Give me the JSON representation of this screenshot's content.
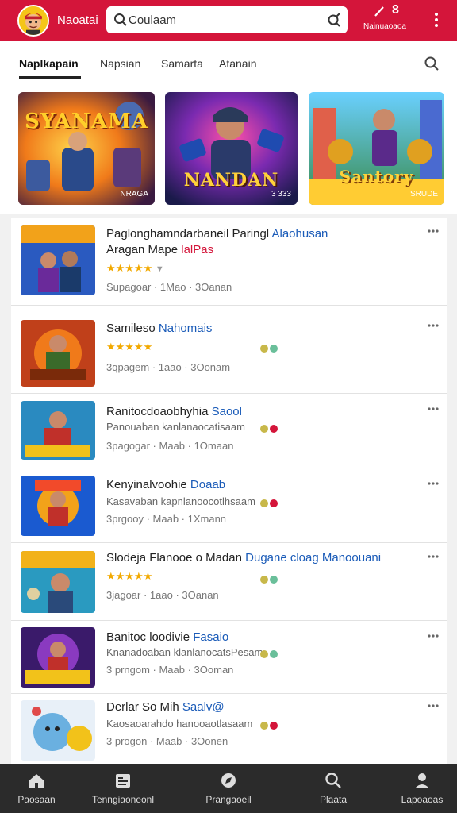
{
  "header": {
    "app_title": "Naoatai",
    "search_value": "Coulaam",
    "notif_count": "8",
    "account_label": "Nainuaoaoa",
    "colors": {
      "brand": "#d4153a"
    }
  },
  "tabs": [
    {
      "label": "Naplkapain"
    },
    {
      "label": "Napsian"
    },
    {
      "label": "Samarta"
    },
    {
      "label": "Atanain"
    }
  ],
  "featured": [
    {
      "title": "SYANAMA",
      "sub": "NRAGA"
    },
    {
      "title": "NANDAN",
      "sub": "3 333"
    },
    {
      "title": "Santory",
      "sub": "SRUDE"
    }
  ],
  "list": [
    {
      "title": "Paglonghamndarbaneil Paringl",
      "title_link": "Alaohusan",
      "title_line2": "Aragan Mape",
      "title_line2_red": "lalPas",
      "stars": "★★★★★",
      "meta": "Supagoar · 1Mao · 3Oanan"
    },
    {
      "title": "Samileso",
      "title_link": "Nahomais",
      "stars": "★★★★★",
      "meta": "3qpagem · 1aao · 3Oonam"
    },
    {
      "title": "Ranitocdoaobhyhia",
      "title_link": "Saool",
      "desc": "Panouaban kanlanaocatisaam",
      "meta": "3pagogar · Maab · 1Omaan"
    },
    {
      "title": "Kenyinalvoohie",
      "title_link": "Doaab",
      "desc": "Kasavaban kapnlanoocotlhsaam",
      "meta": "3prgooy · Maab · 1Xmann"
    },
    {
      "title": "Slodeja Flanooe o Madan",
      "title_link": "Dugane cloag  Manoouani",
      "stars": "★★★★★",
      "meta": "3jagoar · 1aao · 3Oanan"
    },
    {
      "title": "Banitoc loodivie",
      "title_link": "Fasaio",
      "desc": "Knanadoaban klanlanocatsPesam",
      "meta": "3 prngom · Maab · 3Ooman"
    },
    {
      "title": "Derlar So Mih",
      "title_link": "Saalv@",
      "desc": "Kaosaoarahdo hanooaotlasaam",
      "meta": "3 progon · Maab · 3Oonen"
    }
  ],
  "bottom_nav": [
    {
      "label": "Paosaan",
      "icon": "home-icon"
    },
    {
      "label": "Tenngiaoneonl",
      "icon": "library-icon"
    },
    {
      "label": "Prangaoeil",
      "icon": "compass-icon"
    },
    {
      "label": "Plaata",
      "icon": "search-icon"
    },
    {
      "label": "Lapoaoas",
      "icon": "profile-icon"
    }
  ]
}
